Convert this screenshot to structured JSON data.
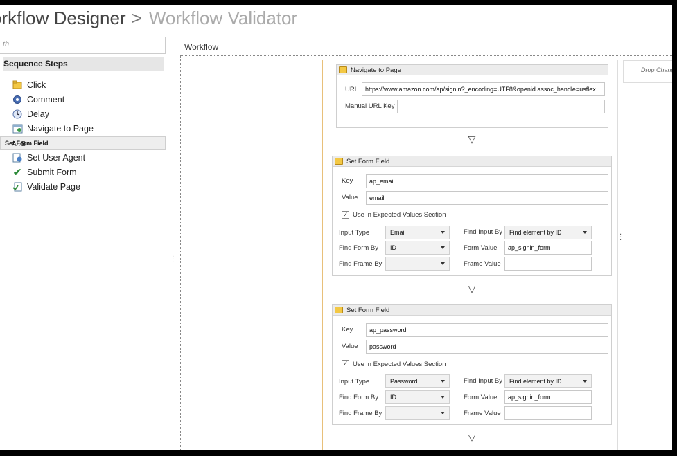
{
  "header": {
    "title": "orkflow Designer",
    "separator": ">",
    "subtitle": "Workflow Validator"
  },
  "search": {
    "placeholder": "th"
  },
  "sidebar": {
    "category": "Sequence Steps",
    "items": [
      {
        "label": "Click",
        "icon": "folder-icon"
      },
      {
        "label": "Comment",
        "icon": "gear-icon"
      },
      {
        "label": "Delay",
        "icon": "clock-icon"
      },
      {
        "label": "Navigate to Page",
        "icon": "web-page-icon"
      },
      {
        "label": "Set Form Field",
        "icon": "ab-text-icon",
        "selected": true
      },
      {
        "label": "Set User Agent",
        "icon": "user-agent-icon"
      },
      {
        "label": "Submit Form",
        "icon": "checkmark-icon"
      },
      {
        "label": "Validate Page",
        "icon": "validate-icon"
      }
    ]
  },
  "workflow": {
    "label": "Workflow",
    "drop_hint": "Drop Chang",
    "steps": [
      {
        "title": "Navigate to Page",
        "url_label": "URL",
        "url_value": "https://www.amazon.com/ap/signin?_encoding=UTF8&openid.assoc_handle=usflex",
        "manual_key_label": "Manual URL Key",
        "manual_key_value": ""
      },
      {
        "title": "Set Form Field",
        "key_label": "Key",
        "key_value": "ap_email",
        "value_label": "Value",
        "value_value": "email",
        "expected_label": "Use in Expected Values Section",
        "expected_checked": true,
        "input_type_label": "Input Type",
        "input_type_value": "Email",
        "find_form_by_label": "Find Form By",
        "find_form_by_value": "ID",
        "find_frame_by_label": "Find Frame By",
        "find_frame_by_value": "",
        "find_input_by_label": "Find Input By",
        "find_input_by_value": "Find element by ID",
        "form_value_label": "Form Value",
        "form_value_value": "ap_signin_form",
        "frame_value_label": "Frame Value",
        "frame_value_value": ""
      },
      {
        "title": "Set Form Field",
        "key_label": "Key",
        "key_value": "ap_password",
        "value_label": "Value",
        "value_value": "password",
        "expected_label": "Use in Expected Values Section",
        "expected_checked": true,
        "input_type_label": "Input Type",
        "input_type_value": "Password",
        "find_form_by_label": "Find Form By",
        "find_form_by_value": "ID",
        "find_frame_by_label": "Find Frame By",
        "find_frame_by_value": "",
        "find_input_by_label": "Find Input By",
        "find_input_by_value": "Find element by ID",
        "form_value_label": "Form Value",
        "form_value_value": "ap_signin_form",
        "frame_value_label": "Frame Value",
        "frame_value_value": ""
      }
    ],
    "connector": "▽"
  }
}
